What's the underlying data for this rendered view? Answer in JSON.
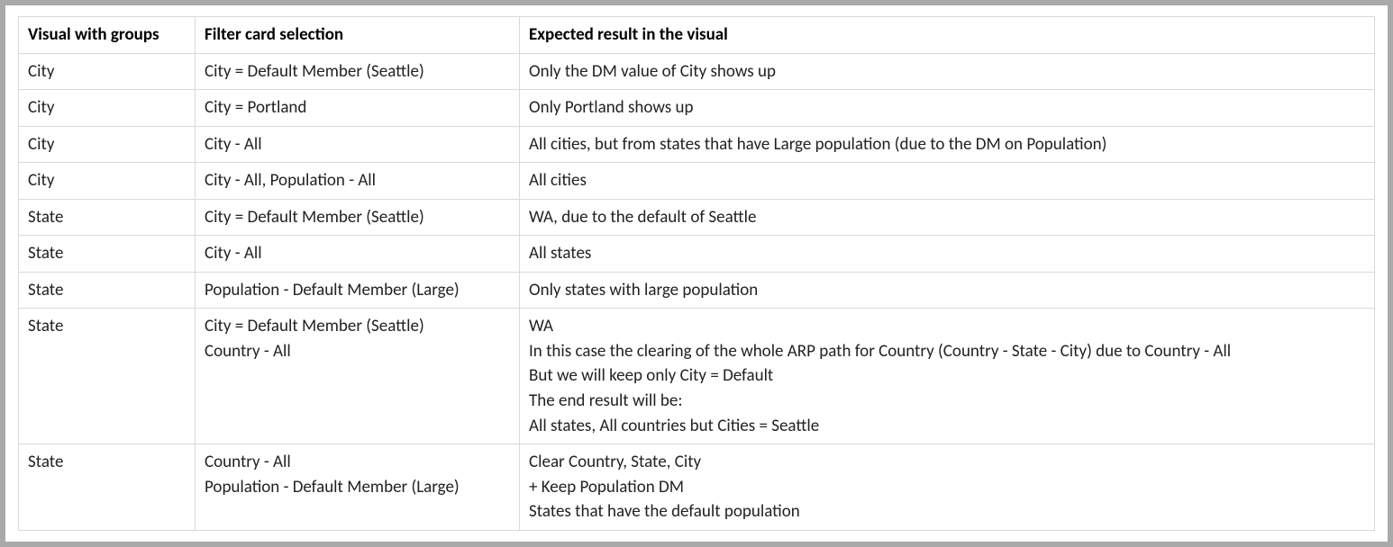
{
  "table": {
    "headers": [
      "Visual with groups",
      "Filter card selection",
      "Expected result in the visual"
    ],
    "rows": [
      {
        "visual": "City",
        "filter": "City = Default Member (Seattle)",
        "result": "Only the DM value of City shows up"
      },
      {
        "visual": "City",
        "filter": "City = Portland",
        "result": "Only Portland shows up"
      },
      {
        "visual": "City",
        "filter": "City - All",
        "result": "All cities, but from states that have Large population (due to the DM on Population)"
      },
      {
        "visual": "City",
        "filter": "City - All, Population - All",
        "result": "All cities"
      },
      {
        "visual": "State",
        "filter": "City = Default Member (Seattle)",
        "result": "WA, due to the default of Seattle"
      },
      {
        "visual": "State",
        "filter": "City - All",
        "result": "All states"
      },
      {
        "visual": "State",
        "filter": "Population - Default Member (Large)",
        "result": "Only states with large population"
      },
      {
        "visual": "State",
        "filter": "City = Default Member (Seattle)\nCountry - All",
        "result": "WA\nIn this case the clearing of the whole ARP path for Country (Country - State - City) due to Country - All\nBut we will keep only City = Default\nThe end result will be:\nAll states, All countries but Cities = Seattle"
      },
      {
        "visual": "State",
        "filter": "Country - All\nPopulation - Default Member (Large)",
        "result": "Clear Country, State, City\n+ Keep Population DM\nStates that have the default population"
      }
    ]
  }
}
